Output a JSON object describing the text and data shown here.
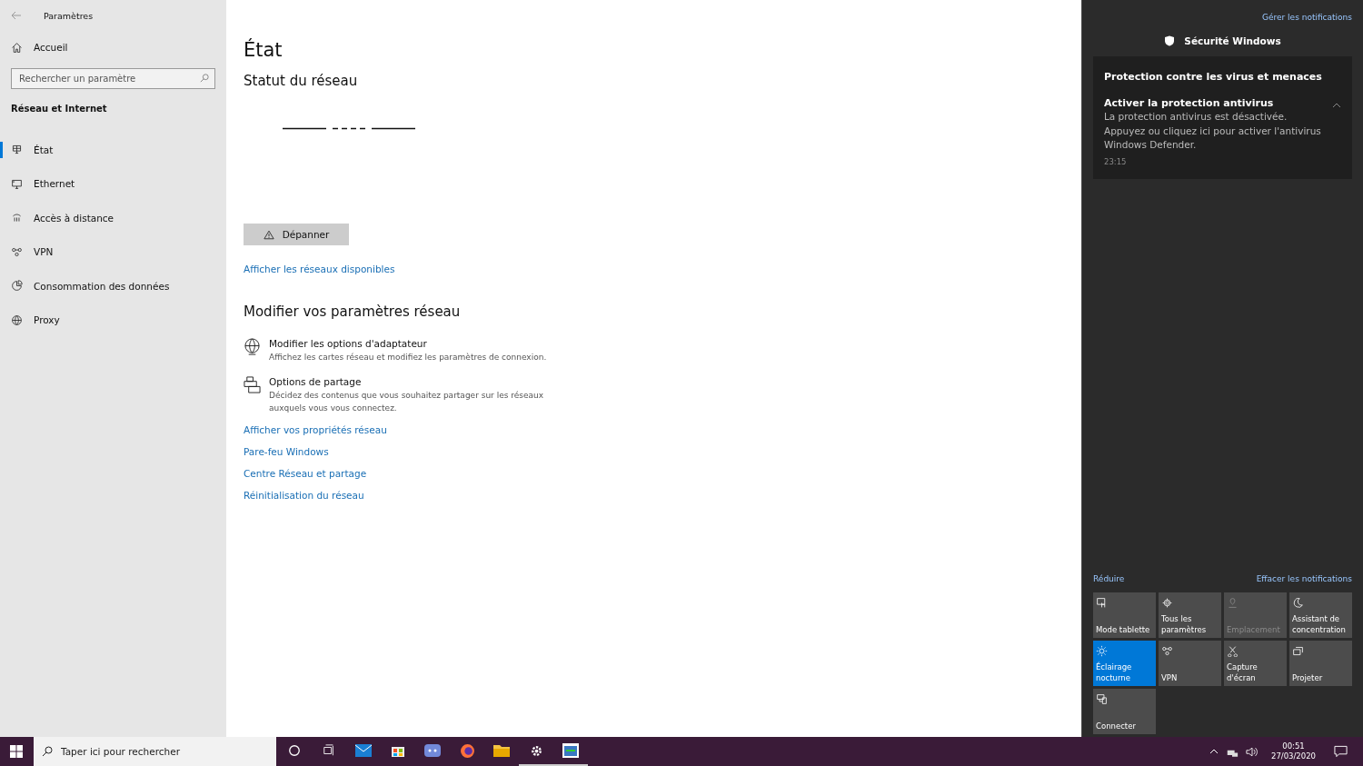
{
  "window": {
    "title": "Paramètres"
  },
  "sidebar": {
    "home": "Accueil",
    "search": {
      "placeholder": "Rechercher un paramètre"
    },
    "section": "Réseau et Internet",
    "items": [
      {
        "label": "État",
        "selected": true
      },
      {
        "label": "Ethernet",
        "selected": false
      },
      {
        "label": "Accès à distance",
        "selected": false
      },
      {
        "label": "VPN",
        "selected": false
      },
      {
        "label": "Consommation des données",
        "selected": false
      },
      {
        "label": "Proxy",
        "selected": false
      }
    ]
  },
  "content": {
    "title": "État",
    "status_heading": "Statut du réseau",
    "troubleshoot_button": "Dépanner",
    "available_link": "Afficher les réseaux disponibles",
    "settings_heading": "Modifier vos paramètres réseau",
    "options": [
      {
        "title": "Modifier les options d'adaptateur",
        "description": "Affichez les cartes réseau et modifiez les paramètres de connexion."
      },
      {
        "title": "Options de partage",
        "description": "Décidez des contenus que vous souhaitez partager sur les réseaux auxquels vous vous connectez."
      }
    ],
    "links": [
      "Afficher vos propriétés réseau",
      "Pare-feu Windows",
      "Centre Réseau et partage",
      "Réinitialisation du réseau"
    ]
  },
  "action_center": {
    "manage_link": "Gérer les notifications",
    "app": "Sécurité Windows",
    "notification": {
      "heading": "Protection contre les virus et menaces",
      "title": "Activer la protection antivirus",
      "body": "La protection antivirus est désactivée. Appuyez ou cliquez ici pour activer l'antivirus Windows Defender.",
      "time": "23:15"
    },
    "collapse_link": "Réduire",
    "clear_link": "Effacer les notifications",
    "tiles": [
      {
        "label": "Mode tablette",
        "on": false,
        "disabled": false
      },
      {
        "label": "Tous les paramètres",
        "on": false,
        "disabled": false
      },
      {
        "label": "Emplacement",
        "on": false,
        "disabled": true
      },
      {
        "label": "Assistant de concentration",
        "on": false,
        "disabled": false
      },
      {
        "label": "Éclairage nocturne",
        "on": true,
        "disabled": false
      },
      {
        "label": "VPN",
        "on": false,
        "disabled": false
      },
      {
        "label": "Capture d'écran",
        "on": false,
        "disabled": false
      },
      {
        "label": "Projeter",
        "on": false,
        "disabled": false
      },
      {
        "label": "Connecter",
        "on": false,
        "disabled": false
      }
    ]
  },
  "taskbar": {
    "search": {
      "placeholder": "Taper ici pour rechercher"
    },
    "apps": [
      {
        "running": false
      },
      {
        "running": false
      },
      {
        "running": false
      },
      {
        "running": false
      },
      {
        "running": false
      },
      {
        "running": false
      },
      {
        "running": false
      },
      {
        "running": true
      },
      {
        "running": true
      }
    ],
    "time": "00:51",
    "date": "27/03/2020"
  }
}
